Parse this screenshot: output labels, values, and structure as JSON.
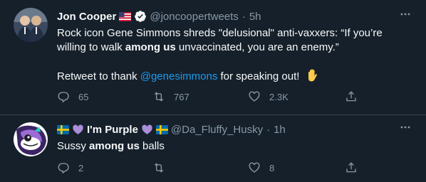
{
  "colors": {
    "background": "#15202b",
    "divider": "#38444d",
    "secondary_text": "#8899a6",
    "primary_text": "#f7f9f9",
    "link": "#1d9bf0"
  },
  "tweets": [
    {
      "display_name": "Jon Cooper",
      "name_badges": [
        "us-flag-icon",
        "verified-badge-icon"
      ],
      "handle": "@joncoopertweets",
      "separator": "·",
      "time": "5h",
      "text": {
        "line1_pre": "Rock icon Gene Simmons shreds \"delusional\" anti-vaxxers: “If you’re willing to walk ",
        "line1_bold": "among us",
        "line1_post": " unvaccinated, you are an enemy.”",
        "line2_pre": "Retweet to thank ",
        "line2_mention": "@genesimmons",
        "line2_post": " for speaking out! "
      },
      "stats": {
        "replies": "65",
        "retweets": "767",
        "likes": "2.3K"
      }
    },
    {
      "display_name": "I'm Purple",
      "name_badges": [
        "sweden-flag-icon",
        "purple-heart-icon",
        "purple-heart-icon",
        "sweden-flag-icon"
      ],
      "handle": "@Da_Fluffy_Husky",
      "separator": "·",
      "time": "1h",
      "text": {
        "line1_pre": "Sussy ",
        "line1_bold": "among us",
        "line1_post": " balls"
      },
      "stats": {
        "replies": "2",
        "retweets": "",
        "likes": "8"
      }
    }
  ]
}
